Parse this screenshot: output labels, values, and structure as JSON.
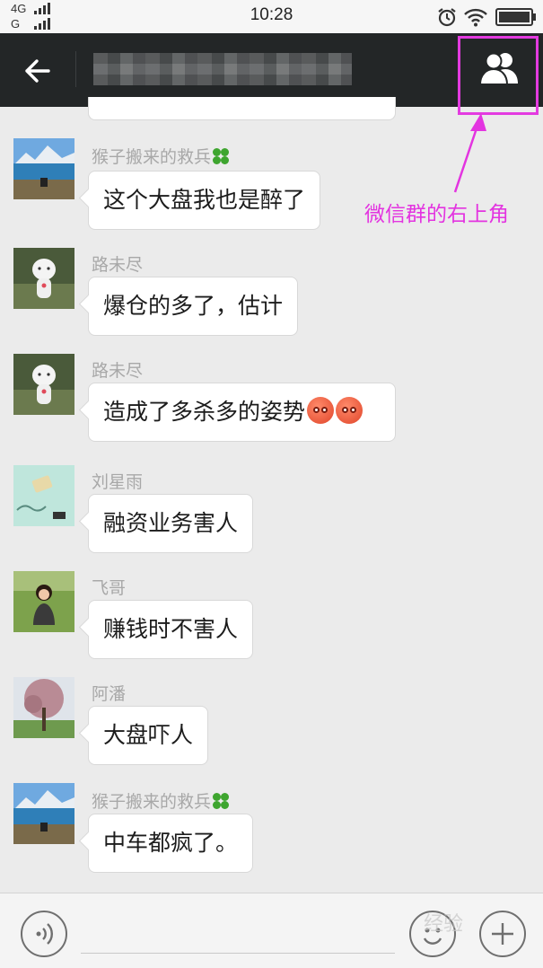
{
  "status_bar": {
    "net_top": "4G",
    "net_bottom": "G",
    "time": "10:28"
  },
  "topbar": {
    "title": "",
    "title_obscured": true
  },
  "annotation": {
    "text": "微信群的右上角",
    "color": "#e334e0"
  },
  "messages": [
    {
      "sender": "猴子搬来的救兵",
      "has_clover": true,
      "text": "这个大盘我也是醉了",
      "avatar": "lake"
    },
    {
      "sender": "路未尽",
      "has_clover": false,
      "text": "爆仓的多了，估计",
      "avatar": "doll"
    },
    {
      "sender": "路未尽",
      "has_clover": false,
      "text": "造成了多杀多的姿势",
      "emojis": 2,
      "avatar": "doll"
    },
    {
      "sender": "刘星雨",
      "has_clover": false,
      "text": "融资业务害人",
      "avatar": "mint"
    },
    {
      "sender": "飞哥",
      "has_clover": false,
      "text": "赚钱时不害人",
      "avatar": "girl"
    },
    {
      "sender": "阿潘",
      "has_clover": false,
      "text": "大盘吓人",
      "avatar": "tree"
    },
    {
      "sender": "猴子搬来的救兵",
      "has_clover": true,
      "text": "中车都疯了。",
      "avatar": "lake"
    }
  ],
  "input_bar": {
    "voice_icon": "voice-icon",
    "emoji_icon": "emoji-icon",
    "plus_icon": "plus-icon"
  },
  "watermark": "经验"
}
